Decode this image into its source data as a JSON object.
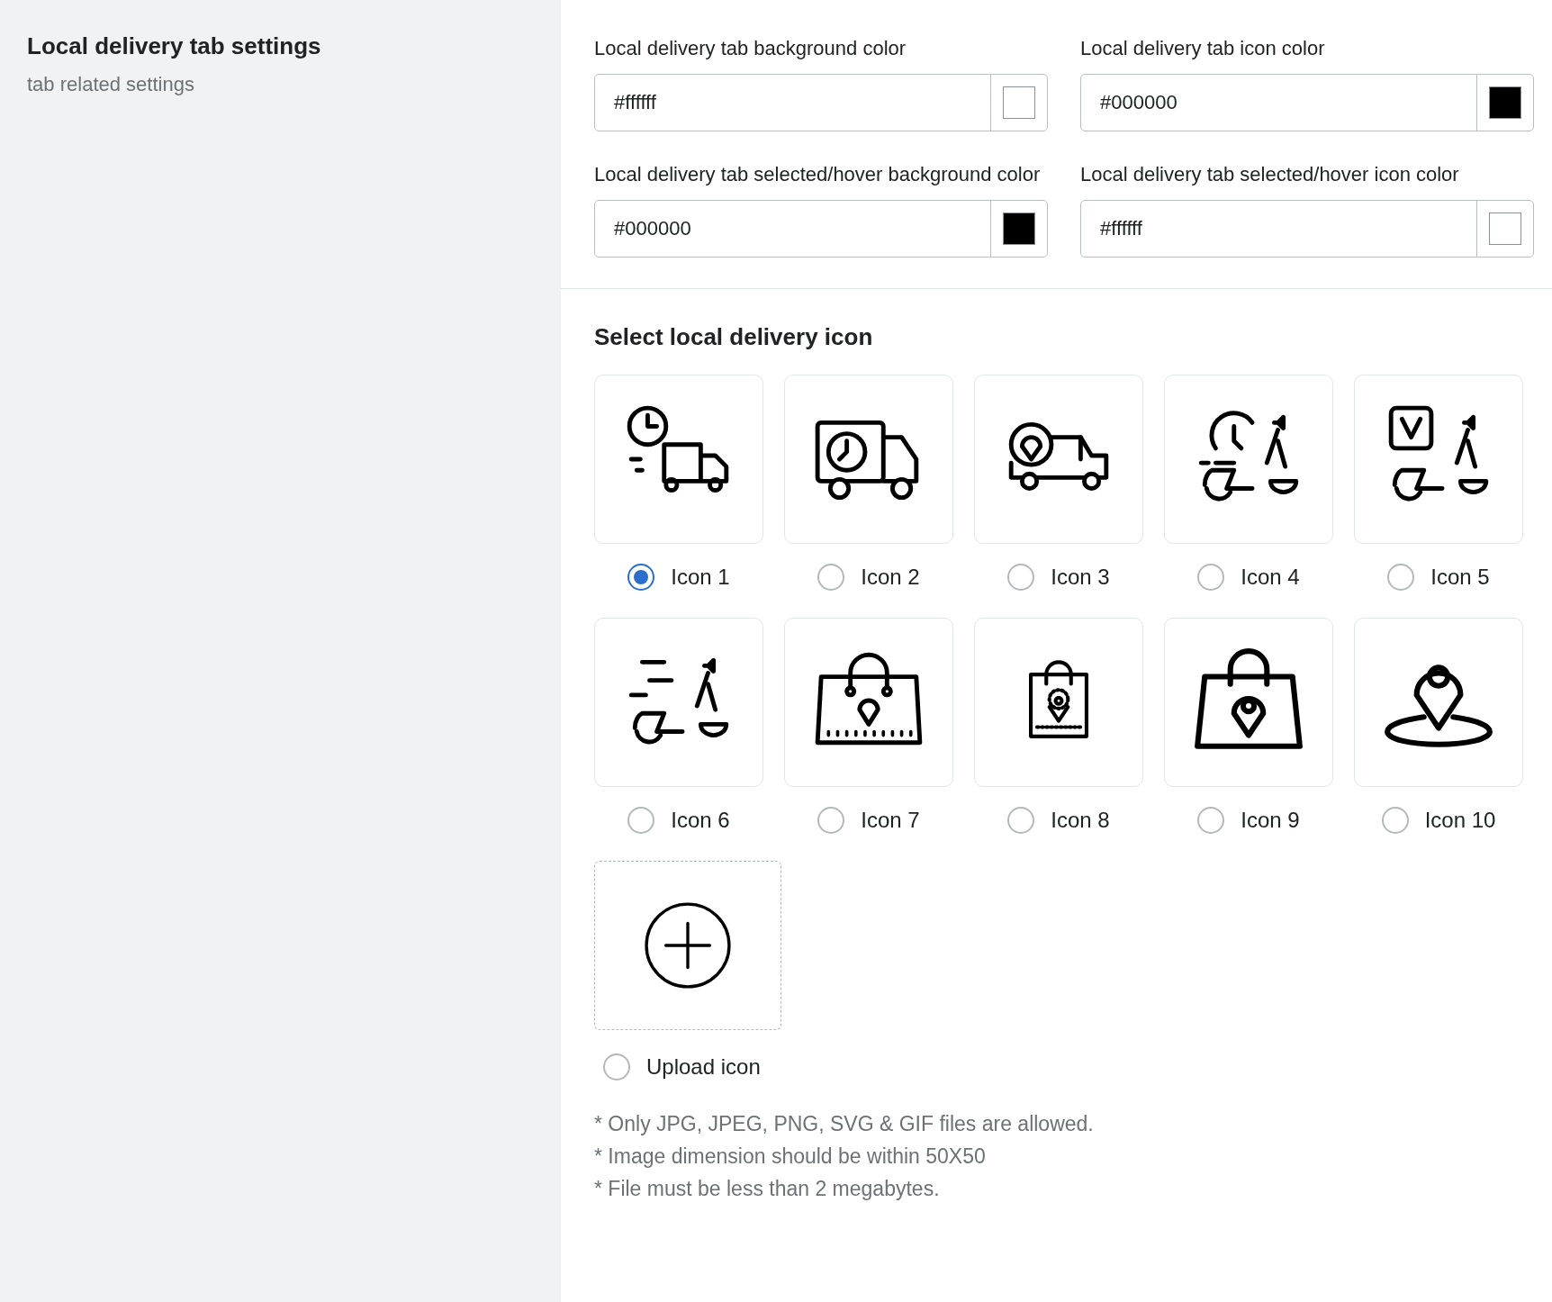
{
  "sidebar": {
    "title": "Local delivery tab settings",
    "subtitle": "tab related settings"
  },
  "color_fields": [
    {
      "label": "Local delivery tab background color",
      "value": "#ffffff",
      "color": "#ffffff"
    },
    {
      "label": "Local delivery tab icon color",
      "value": "#000000",
      "color": "#000000"
    },
    {
      "label": "Local delivery tab selected/hover background color",
      "value": "#000000",
      "color": "#000000"
    },
    {
      "label": "Local delivery tab selected/hover icon color",
      "value": "#ffffff",
      "color": "#ffffff"
    }
  ],
  "icon_section": {
    "title": "Select local delivery icon",
    "options": [
      {
        "label": "Icon 1",
        "selected": true
      },
      {
        "label": "Icon 2",
        "selected": false
      },
      {
        "label": "Icon 3",
        "selected": false
      },
      {
        "label": "Icon 4",
        "selected": false
      },
      {
        "label": "Icon 5",
        "selected": false
      },
      {
        "label": "Icon 6",
        "selected": false
      },
      {
        "label": "Icon 7",
        "selected": false
      },
      {
        "label": "Icon 8",
        "selected": false
      },
      {
        "label": "Icon 9",
        "selected": false
      },
      {
        "label": "Icon 10",
        "selected": false
      }
    ],
    "upload": {
      "label": "Upload icon",
      "selected": false
    }
  },
  "notes": [
    "* Only JPG, JPEG, PNG, SVG & GIF files are allowed.",
    "* Image dimension should be within 50X50",
    "* File must be less than 2 megabytes."
  ]
}
